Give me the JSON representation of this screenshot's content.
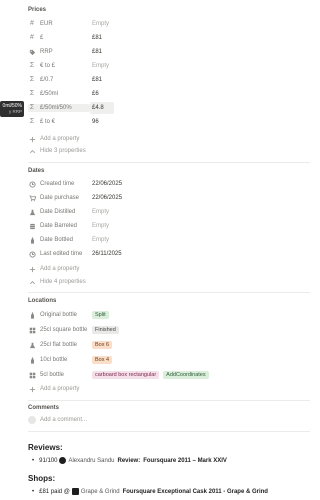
{
  "tooltip": {
    "line1": "0ml/50%",
    "line2": "y RRP"
  },
  "prices": {
    "title": "Prices",
    "rows": [
      {
        "icon": "hash-icon",
        "name": "EUR",
        "value": "Empty",
        "empty": true
      },
      {
        "icon": "hash-icon",
        "name": "£",
        "value": "£81",
        "empty": false
      },
      {
        "icon": "tag-icon",
        "name": "RRP",
        "value": "£81",
        "empty": false
      },
      {
        "icon": "sigma-icon",
        "name": "€ to £",
        "value": "Empty",
        "empty": true
      },
      {
        "icon": "sigma-icon",
        "name": "£/0.7",
        "value": "£81",
        "empty": false
      },
      {
        "icon": "sigma-icon",
        "name": "£/50ml",
        "value": "£6",
        "empty": false
      },
      {
        "icon": "sigma-icon",
        "name": "£/50ml/50%",
        "value": "£4.8",
        "empty": false
      },
      {
        "icon": "sigma-icon",
        "name": "£ to €",
        "value": "96",
        "empty": false
      }
    ],
    "add_label": "Add a property",
    "hide_label": "Hide 3 properties"
  },
  "dates": {
    "title": "Dates",
    "rows": [
      {
        "icon": "clock-icon",
        "name": "Created time",
        "value": "22/06/2025",
        "empty": false
      },
      {
        "icon": "cart-icon",
        "name": "Date purchase",
        "value": "22/06/2025",
        "empty": false
      },
      {
        "icon": "flask-icon",
        "name": "Date Distilled",
        "value": "Empty",
        "empty": true
      },
      {
        "icon": "barrel-icon",
        "name": "Date Barreled",
        "value": "Empty",
        "empty": true
      },
      {
        "icon": "bottle-icon",
        "name": "Date Bottled",
        "value": "Empty",
        "empty": true
      },
      {
        "icon": "clock-icon",
        "name": "Last edited time",
        "value": "26/11/2025",
        "empty": false
      }
    ],
    "add_label": "Add a property",
    "hide_label": "Hide 4 properties"
  },
  "locations": {
    "title": "Locations",
    "rows": [
      {
        "icon": "bottle-icon",
        "name": "Original bottle",
        "tags": [
          {
            "text": "Split",
            "color": "green"
          }
        ]
      },
      {
        "icon": "grid-icon",
        "name": "25cl square bottle",
        "tags": [
          {
            "text": "Finished",
            "color": "gray"
          }
        ]
      },
      {
        "icon": "flask-icon",
        "name": "25cl flat bottle",
        "tags": [
          {
            "text": "Box 6",
            "color": "orange"
          }
        ]
      },
      {
        "icon": "bottle-icon",
        "name": "10cl bottle",
        "tags": [
          {
            "text": "Box 4",
            "color": "orange"
          }
        ]
      },
      {
        "icon": "grid-icon",
        "name": "5cl bottle",
        "tags": [
          {
            "text": "carboard box rectangular",
            "color": "pink"
          },
          {
            "text": "AddCoordinates",
            "color": "green"
          }
        ]
      }
    ],
    "add_label": "Add a property"
  },
  "comments": {
    "title": "Comments",
    "placeholder": "Add a comment..."
  },
  "reviews": {
    "heading": "Reviews:",
    "items": [
      {
        "score": "91/100",
        "author": "Alexandru Sandu",
        "label": "Review:",
        "title": "Foursquare 2011 – Mark XXIV"
      }
    ]
  },
  "shops": {
    "heading": "Shops:",
    "items": [
      {
        "price": "£81 paid @",
        "shop": "Grape & Grind",
        "title": "Foursquare Exceptional Cask 2011 - Grape & Grind"
      }
    ]
  },
  "colors": {
    "tag_green": "#dbeddb",
    "tag_gray": "#e9e9e7",
    "tag_orange": "#fadec9",
    "tag_pink": "#f5e0e9",
    "tooltip_bg": "#2f2f2f"
  }
}
